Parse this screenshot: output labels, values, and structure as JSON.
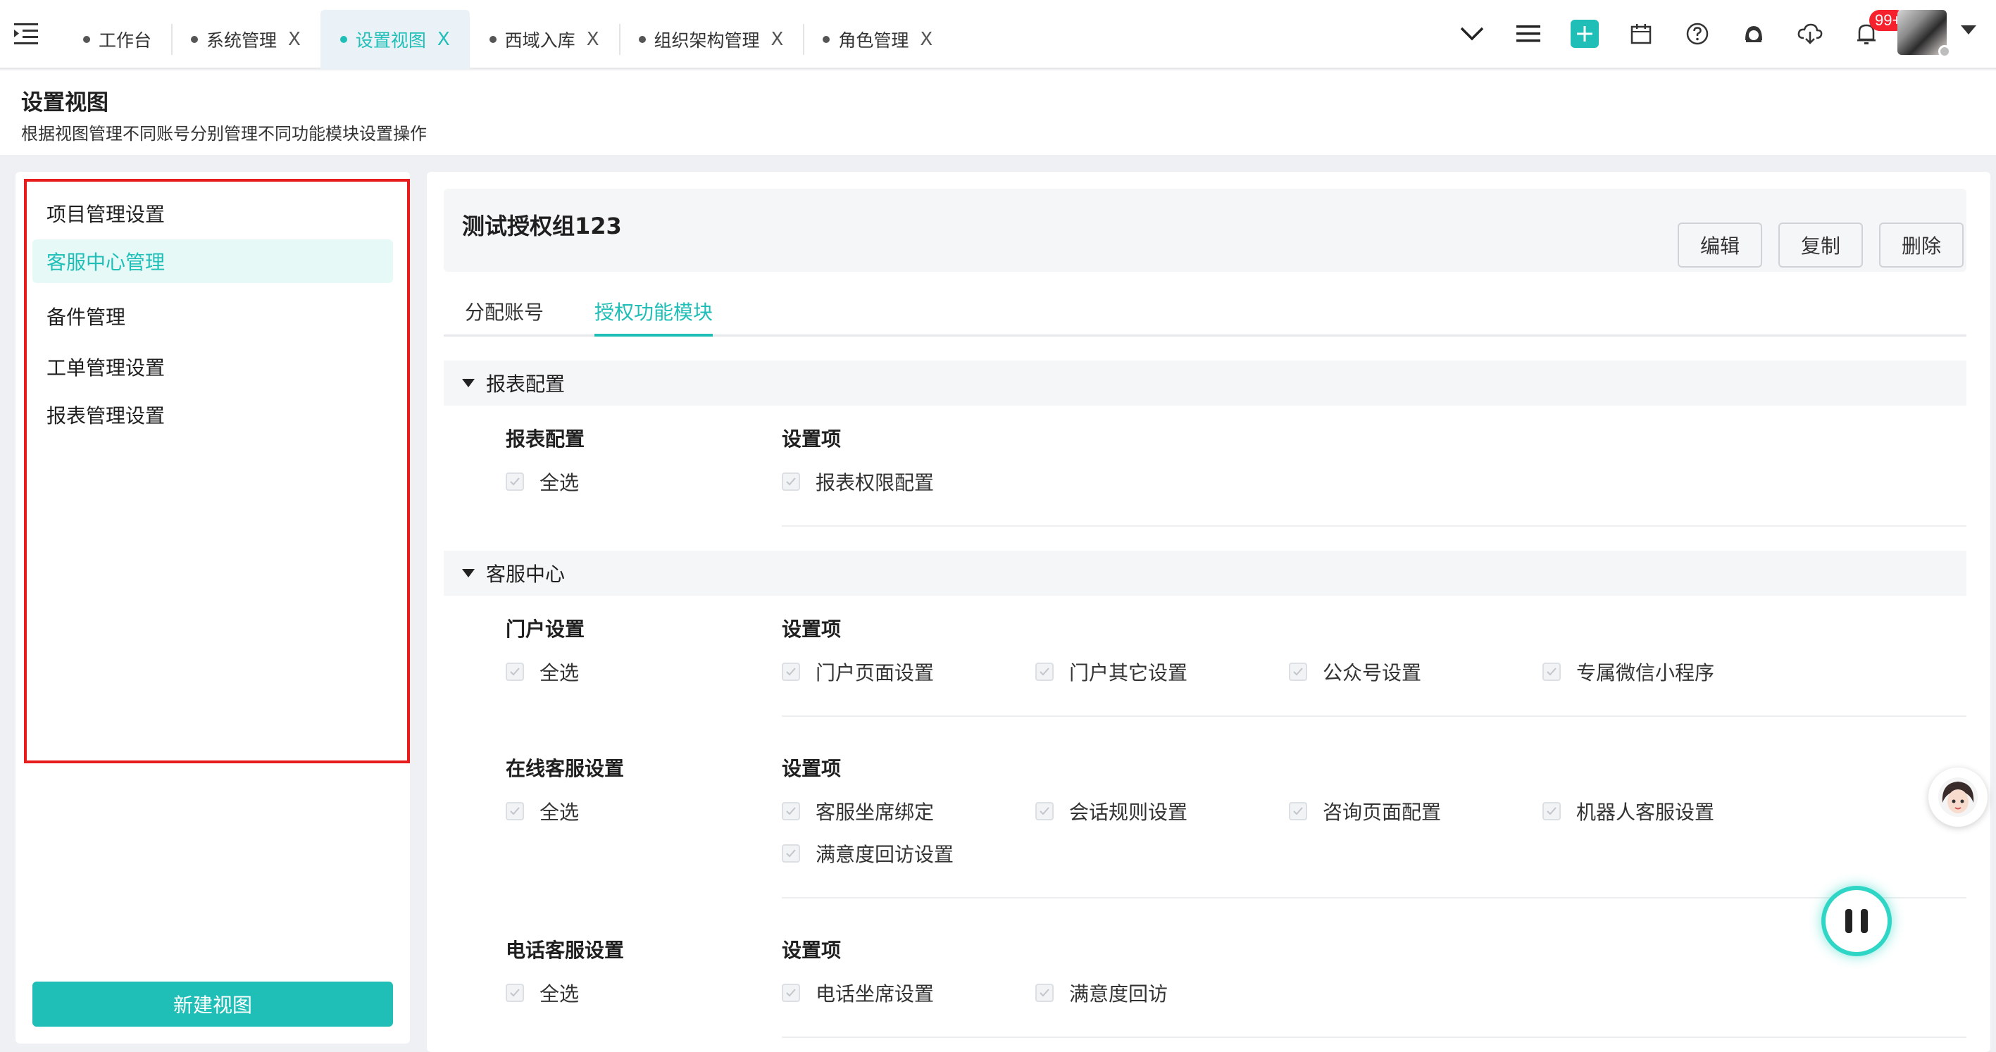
{
  "tabs": [
    {
      "label": "工作台",
      "closable": false,
      "active": false
    },
    {
      "label": "系统管理",
      "closable": true,
      "active": false
    },
    {
      "label": "设置视图",
      "closable": true,
      "active": true
    },
    {
      "label": "西域入库",
      "closable": true,
      "active": false
    },
    {
      "label": "组织架构管理",
      "closable": true,
      "active": false
    },
    {
      "label": "角色管理",
      "closable": true,
      "active": false
    }
  ],
  "close_glyph": "X",
  "toolbar": {
    "icons": [
      "chevron-down-icon",
      "list-icon",
      "add-icon",
      "calendar-icon",
      "help-icon",
      "service-icon",
      "cloud-download-icon",
      "bell-icon"
    ],
    "notification_badge": "99+"
  },
  "page": {
    "title": "设置视图",
    "subtitle": "根据视图管理不同账号分别管理不同功能模块设置操作"
  },
  "sidebar": {
    "items": [
      "项目管理设置",
      "客服中心管理",
      "备件管理",
      "工单管理设置",
      "报表管理设置"
    ],
    "active_index": 1,
    "new_view_label": "新建视图"
  },
  "group": {
    "title": "测试授权组123",
    "edit_label": "编辑",
    "copy_label": "复制",
    "delete_label": "删除"
  },
  "subtabs": [
    "分配账号",
    "授权功能模块"
  ],
  "active_subtab": 1,
  "sections": {
    "report": {
      "title": "报表配置",
      "col1_title": "报表配置",
      "col2_title": "设置项",
      "select_all": "全选",
      "items": [
        "报表权限配置"
      ]
    },
    "service": {
      "title": "客服中心",
      "portal": {
        "col1_title": "门户设置",
        "col2_title": "设置项",
        "select_all": "全选",
        "items": [
          "门户页面设置",
          "门户其它设置",
          "公众号设置",
          "专属微信小程序"
        ]
      },
      "online": {
        "col1_title": "在线客服设置",
        "col2_title": "设置项",
        "select_all": "全选",
        "items": [
          "客服坐席绑定",
          "会话规则设置",
          "咨询页面配置",
          "机器人客服设置",
          "满意度回访设置"
        ]
      },
      "phone": {
        "col1_title": "电话客服设置",
        "col2_title": "设置项",
        "select_all": "全选",
        "items": [
          "电话坐席设置",
          "满意度回访"
        ]
      }
    }
  },
  "colors": {
    "accent": "#1fbfb7",
    "highlight_border": "#e81c1c",
    "badge": "#f5222d"
  }
}
